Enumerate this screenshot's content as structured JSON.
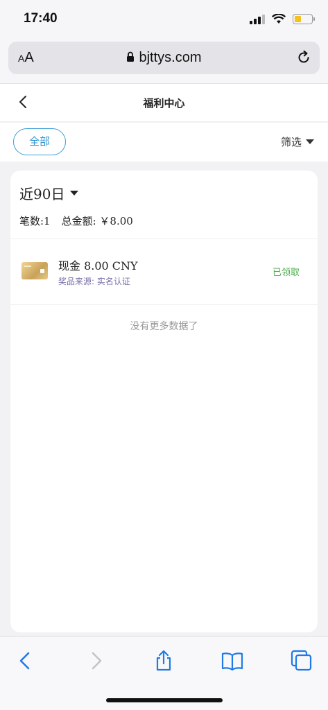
{
  "status_bar": {
    "time": "17:40"
  },
  "browser": {
    "aa_small": "A",
    "aa_large": "A",
    "domain": "bjttys.com"
  },
  "header": {
    "title": "福利中心"
  },
  "filter": {
    "all_label": "全部",
    "filter_label": "筛选"
  },
  "card": {
    "period": "近90日",
    "count_label": "笔数:1",
    "total_label": "总金额: ￥8.00",
    "item": {
      "title": "现金 8.00 CNY",
      "source": "奖品来源: 实名认证",
      "status": "已领取"
    },
    "no_more": "没有更多数据了"
  },
  "colors": {
    "accent": "#2f95d0",
    "claimed": "#4cae4c",
    "battery": "#f4c21a"
  }
}
